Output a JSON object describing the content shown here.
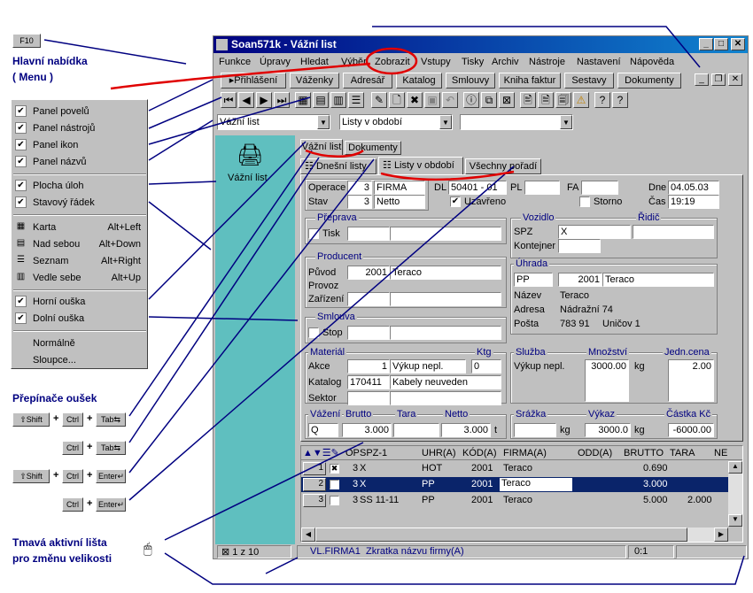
{
  "keys": {
    "f10": "F10",
    "shift": "⇧Shift",
    "ctrl": "Ctrl",
    "tab": "Tab⇆",
    "enter": "Enter↵",
    "plus": "+"
  },
  "notes": {
    "menu_title": "Hlavní nabídka",
    "menu_sub": "( Menu )",
    "tabs_switch": "Přepínače oušek",
    "active_bar_1": "Tmavá aktivní lišta",
    "active_bar_2": "pro změnu velikosti"
  },
  "ctx": {
    "items": [
      {
        "label": "Panel povelů",
        "check": "✔"
      },
      {
        "label": "Panel nástrojů",
        "check": "✔"
      },
      {
        "label": "Panel ikon",
        "check": "✔"
      },
      {
        "label": "Panel názvů",
        "check": "✔"
      },
      {
        "label": "Plocha úloh",
        "check": "✔"
      },
      {
        "label": "Stavový řádek",
        "check": "✔"
      },
      {
        "label": "Karta",
        "shortcut": "Alt+Left"
      },
      {
        "label": "Nad sebou",
        "shortcut": "Alt+Down"
      },
      {
        "label": "Seznam",
        "shortcut": "Alt+Right"
      },
      {
        "label": "Vedle sebe",
        "shortcut": "Alt+Up"
      },
      {
        "label": "Horní ouška",
        "check": "✔"
      },
      {
        "label": "Dolní ouška",
        "check": "✔"
      },
      {
        "label": "Normálně"
      },
      {
        "label": "Sloupce..."
      }
    ]
  },
  "window": {
    "title": "Soan571k - Vážní list",
    "menu": [
      "Funkce",
      "Úpravy",
      "Hledat",
      "Výběr",
      "Zobrazit",
      "Vstupy",
      "Tisky",
      "Archiv",
      "Nástroje",
      "Nastavení",
      "Nápověda"
    ],
    "cmd_tabs": [
      "Přihlášení",
      "Váženky",
      "Adresář",
      "Katalog",
      "Smlouvy",
      "Kniha faktur",
      "Sestavy",
      "Dokumenty"
    ],
    "combo1": "Vážní list",
    "combo2": "Listy v období",
    "combo3": "",
    "left_label": "Vážní list",
    "top_tabs": [
      "Vážní list",
      "Dokumenty"
    ],
    "sub_tabs": [
      "Dnešní listy",
      "Listy v období",
      "Všechny pořadí"
    ]
  },
  "form": {
    "operace_label": "Operace",
    "operace_num": "3",
    "operace_val": "FIRMA",
    "stav_label": "Stav",
    "stav_num": "3",
    "stav_val": "Netto",
    "dl_label": "DL",
    "dl_val": "50401 - 01",
    "pl_label": "PL",
    "fa_label": "FA",
    "uzavreno": "Uzavřeno",
    "storno": "Storno",
    "den_label": "Dne",
    "den_val": "04.05.03",
    "cas_label": "Čas",
    "cas_val": "19:19",
    "preprava": "Přeprava",
    "tisk": "Tisk",
    "vozidlo": "Vozidlo",
    "ridic": "Řidič",
    "spz": "SPZ",
    "spz_val": "X",
    "kontejner": "Kontejner",
    "producent": "Producent",
    "puvod": "Původ",
    "puvod_num": "2001",
    "puvod_val": "Teraco",
    "provoz": "Provoz",
    "zarizeni": "Zařízení",
    "uhrada": "Úhrada",
    "uhrada_code": "PP",
    "uhrada_num": "2001",
    "uhrada_val": "Teraco",
    "nazev_label": "Název",
    "nazev_val": "Teraco",
    "adresa_label": "Adresa",
    "adresa_val": "Nádražní 74",
    "posta_label": "Pošta",
    "posta_psc": "783 91",
    "posta_val": "Uničov 1",
    "smlouva": "Smlouva",
    "stop": "Stop",
    "material": "Materiál",
    "ktg": "Ktg",
    "akce_label": "Akce",
    "akce_num": "1",
    "akce_val": "Výkup nepl.",
    "akce_ktg": "0",
    "katalog_label": "Katalog",
    "katalog_num": "170411",
    "katalog_val": "Kabely neuveden",
    "sektor_label": "Sektor",
    "sluzba": "Služba",
    "sluzba_val": "Výkup nepl.",
    "mnozstvi": "Množství",
    "mnozstvi_val": "3000.00",
    "kg": "kg",
    "jedn_cena": "Jedn.cena",
    "jedn_cena_val": "2.00",
    "vazeni": "Vážení",
    "vazeni_val": "Q",
    "brutto": "Brutto",
    "brutto_val": "3.000",
    "tara": "Tara",
    "netto": "Netto",
    "netto_val": "3.000",
    "t": "t",
    "srazka": "Srážka",
    "vykaz": "Výkaz",
    "vykaz_val": "3000.0",
    "castka": "Částka Kč",
    "castka_val": "-6000.00"
  },
  "grid": {
    "headers": [
      "OP",
      "SPZ-1",
      "UHR(A)",
      "KÓD(A)",
      "FIRMA(A)",
      "ODD(A)",
      "BRUTTO",
      "TARA",
      "NE"
    ],
    "rows": [
      {
        "n": "1",
        "check": "✖",
        "op": "3",
        "spz": "X",
        "uhr": "HOT",
        "kod": "2001",
        "firma": "Teraco",
        "brutto": "0.690",
        "tara": ""
      },
      {
        "n": "2",
        "check": "",
        "op": "3",
        "spz": "X",
        "uhr": "PP",
        "kod": "2001",
        "firma": "Teraco",
        "brutto": "3.000",
        "tara": ""
      },
      {
        "n": "3",
        "check": "",
        "op": "3",
        "spz": "SS 11-11",
        "uhr": "PP",
        "kod": "2001",
        "firma": "Teraco",
        "brutto": "5.000",
        "tara": "2.000"
      }
    ]
  },
  "status": {
    "rec": "1 z 10",
    "field": "VL.FIRMA1",
    "desc": "Zkratka názvu firmy(A)",
    "pos": "0:1"
  },
  "colors": {
    "title": "#000080",
    "teal": "#5fbfbf",
    "select": "#0a246a",
    "annot": "#000080",
    "red": "#e00000"
  }
}
